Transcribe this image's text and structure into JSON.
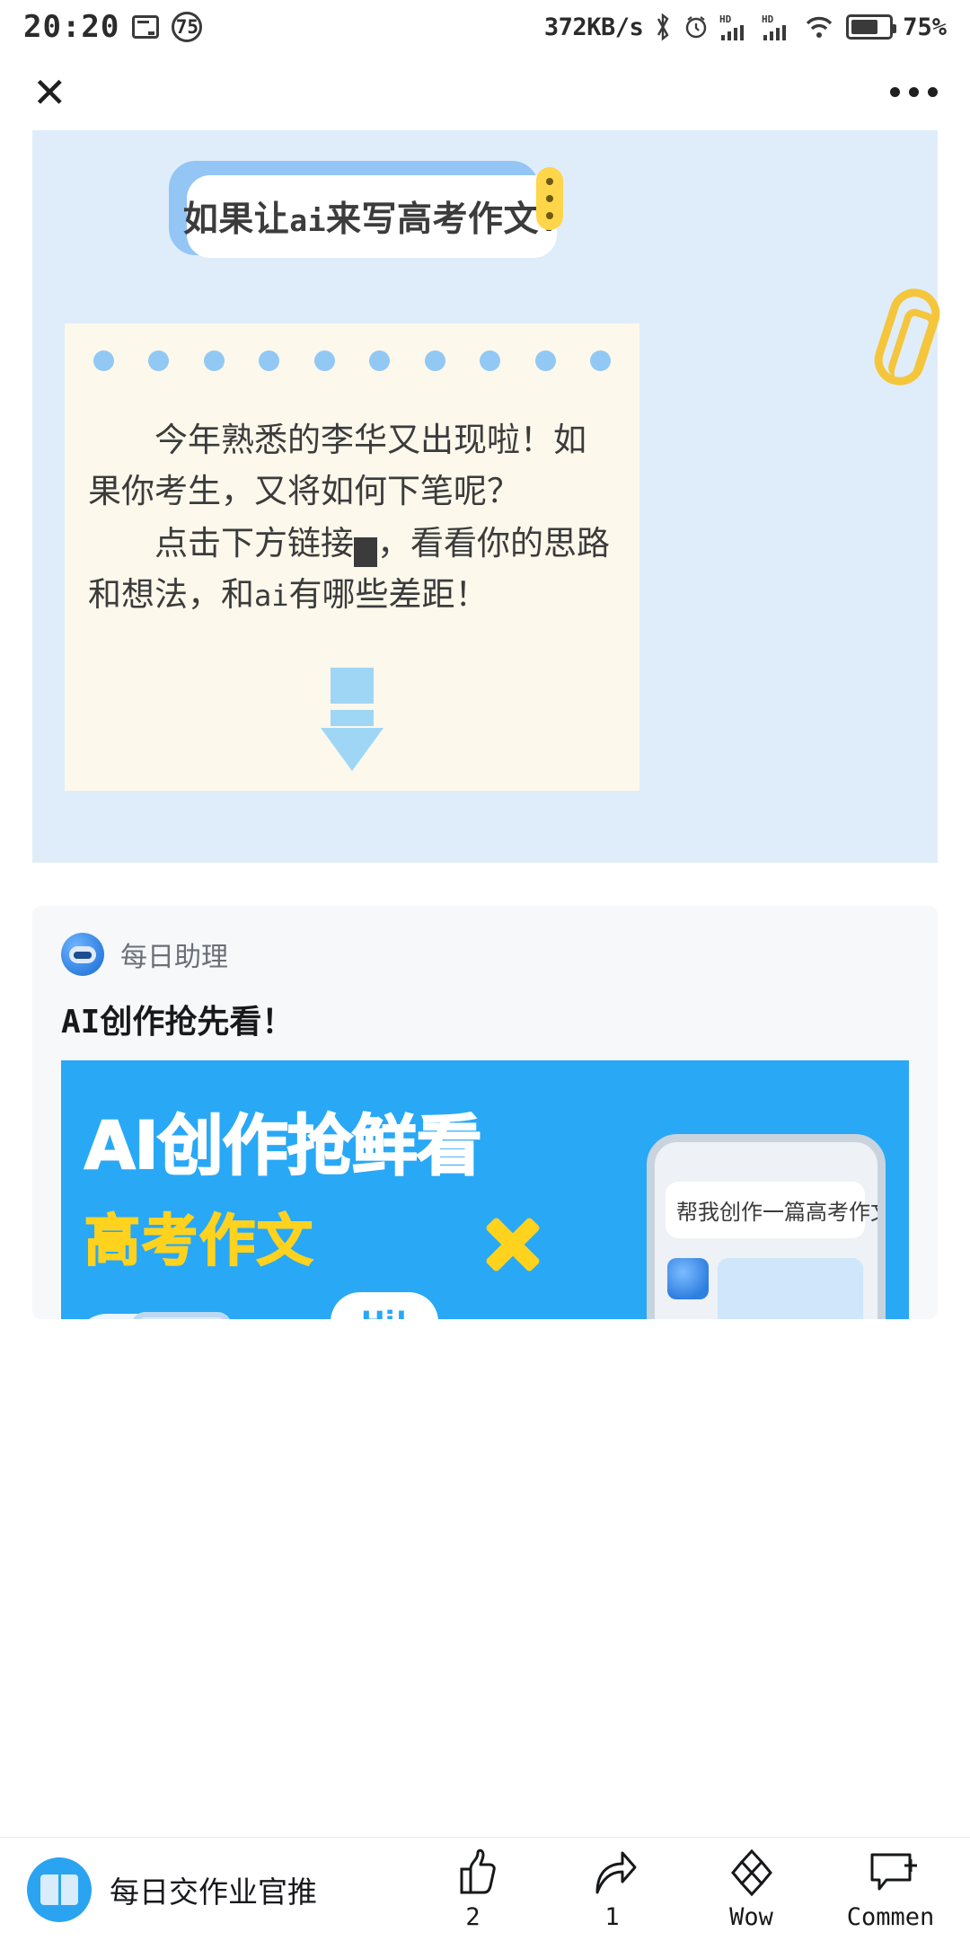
{
  "status_bar": {
    "time": "20:20",
    "screen_icon": "screen-record-icon",
    "badge_count": "75",
    "network_speed": "372KB/s",
    "bluetooth_icon": "bluetooth-icon",
    "alarm_icon": "alarm-icon",
    "signal_1": "HD",
    "signal_2": "HD",
    "wifi_icon": "wifi-icon",
    "battery_percent": "75%"
  },
  "nav": {
    "close_label": "✕",
    "more_label": "more-options"
  },
  "hero": {
    "bubble_title_pre": "如果让",
    "bubble_title_lat": "ai",
    "bubble_title_post": "来写高考作文?",
    "clip_icon": "paperclip-icon",
    "note": {
      "dot_count": 10,
      "line1": "今年熟悉的李华又出现啦！如果你考生，又将如何下笔呢？",
      "line2_a": "点击下方链接",
      "line2_tofu": "?",
      "line2_b": "，看看你的思路和想法，和",
      "line2_lat": "ai",
      "line2_c": "有哪些差距！"
    },
    "arrow_icon": "down-arrow-icon",
    "colors": {
      "poster_bg": "#dfedfb",
      "bubble_shadow": "#93c5f5",
      "note_bg": "#fdf8ec",
      "dot": "#92c8f4",
      "arrow": "#9fd6f5",
      "clip": "#f5c63c"
    }
  },
  "article_card": {
    "source_name": "每日助理",
    "source_avatar": "robot-avatar-icon",
    "title_lat": "AI",
    "title_rest": "创作抢先看！",
    "banner": {
      "headline": "AI创作抢鲜看",
      "subhead": "高考作文",
      "phone_bubble": "帮我创作一篇高考作文",
      "hi_text": "Hi!",
      "bg_color": "#29a8f5",
      "accent_color": "#ffd21e"
    }
  },
  "bottom_bar": {
    "account_name": "每日交作业官推",
    "account_avatar": "book-avatar-icon",
    "actions": [
      {
        "icon": "thumbs-up-icon",
        "label": "2"
      },
      {
        "icon": "share-icon",
        "label": "1"
      },
      {
        "icon": "wow-icon",
        "label": "Wow"
      },
      {
        "icon": "comment-icon",
        "label": "Commen"
      }
    ]
  }
}
